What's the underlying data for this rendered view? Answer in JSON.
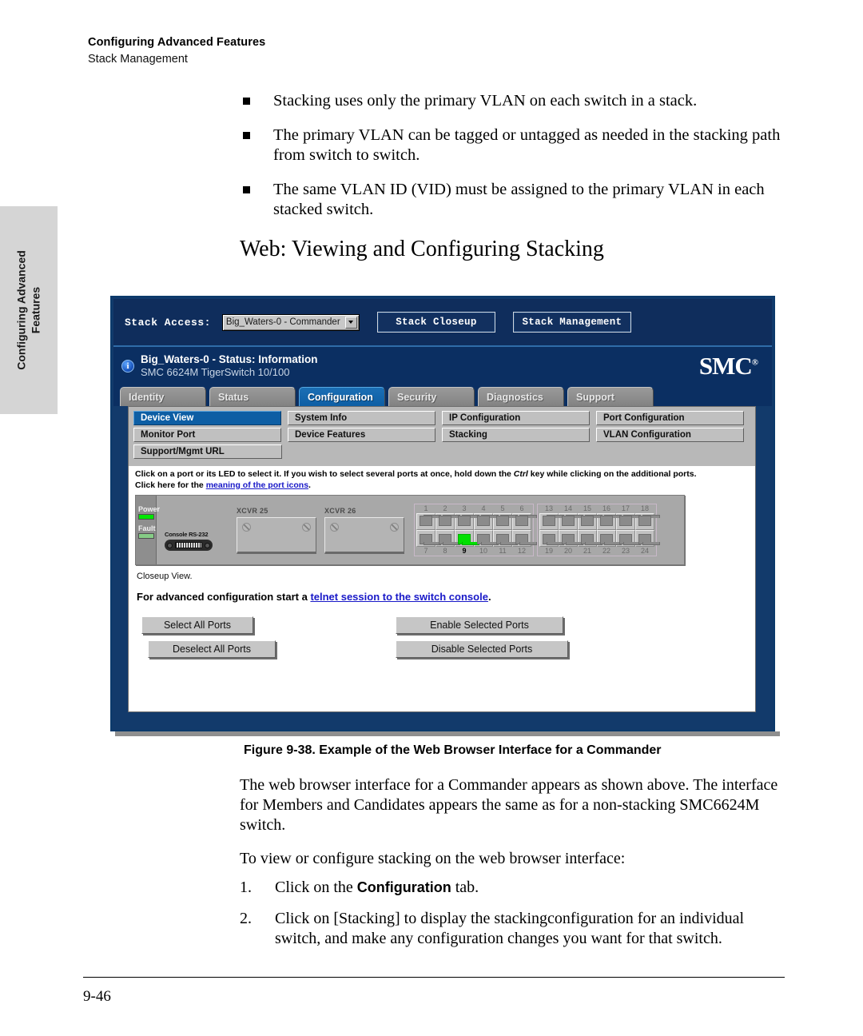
{
  "running_head": {
    "chapter": "Configuring Advanced Features",
    "section": "Stack Management"
  },
  "thumb_tab": {
    "line1": "Configuring Advanced",
    "line2": "Features"
  },
  "bullets": [
    "Stacking uses only the primary VLAN on each switch in a stack.",
    "The primary VLAN can be tagged or untagged as needed in the stacking path from switch to switch.",
    "The same VLAN ID (VID) must be assigned to the primary VLAN in each stacked switch."
  ],
  "heading": "Web: Viewing and Configuring Stacking",
  "screenshot": {
    "toolbar": {
      "stack_access_label": "Stack Access:",
      "stack_access_value": "Big_Waters-0 - Commander",
      "stack_closeup_button": "Stack Closeup",
      "stack_management_button": "Stack Management"
    },
    "status": {
      "title": "Big_Waters-0 - Status: Information",
      "subtitle": "SMC 6624M TigerSwitch 10/100",
      "logo": "SMC"
    },
    "tabs": [
      {
        "label": "Identity",
        "active": false
      },
      {
        "label": "Status",
        "active": false
      },
      {
        "label": "Configuration",
        "active": true
      },
      {
        "label": "Security",
        "active": false
      },
      {
        "label": "Diagnostics",
        "active": false
      },
      {
        "label": "Support",
        "active": false
      }
    ],
    "subtabs": [
      [
        "Device View",
        "System Info",
        "IP Configuration",
        "Port Configuration"
      ],
      [
        "Monitor Port",
        "Device Features",
        "Stacking",
        "VLAN Configuration"
      ],
      [
        "Support/Mgmt URL"
      ]
    ],
    "selected_subtab": "Device View",
    "instructions": {
      "line1_a": "Click on a port or its LED to select it. If you wish to select several ports at once, hold down the ",
      "line1_key": "Ctrl",
      "line1_b": " key while clicking on the additional ports.",
      "line2_a": "Click here for the ",
      "line2_link": "meaning of the port icons",
      "line2_b": "."
    },
    "device": {
      "leds": [
        {
          "label": "Power",
          "state": "on"
        },
        {
          "label": "Fault",
          "state": "dim"
        }
      ],
      "console_label": "Console RS-232",
      "xcvr": [
        "XCVR 25",
        "XCVR 26"
      ],
      "port_group_1": {
        "top_numbers": [
          "1",
          "2",
          "3",
          "4",
          "5",
          "6"
        ],
        "bottom_numbers": [
          "7",
          "8",
          "9",
          "10",
          "11",
          "12"
        ],
        "selected_port": "9"
      },
      "port_group_2": {
        "top_numbers": [
          "13",
          "14",
          "15",
          "16",
          "17",
          "18"
        ],
        "bottom_numbers": [
          "19",
          "20",
          "21",
          "22",
          "23",
          "24"
        ],
        "selected_port": ""
      },
      "closeup_label": "Closeup View."
    },
    "advanced": {
      "prefix": "For advanced configuration start a ",
      "link": "telnet session to the switch console",
      "suffix": "."
    },
    "buttons": {
      "select_all": "Select All Ports",
      "deselect_all": "Deselect All Ports",
      "enable_selected": "Enable Selected Ports",
      "disable_selected": "Disable Selected Ports"
    },
    "colors": {
      "chrome_blue": "#0f2d5c",
      "active_tab_blue": "#0d5ea4",
      "led_green": "#00e800",
      "link_blue": "#1818c8"
    }
  },
  "figure_caption": "Figure 9-38.  Example of the Web Browser Interface for a Commander",
  "after_figure_paragraph": "The web browser interface for a Commander appears as shown above. The interface for Members and Candidates appears the same as for a non-stacking SMC6624M switch.",
  "lead_in": "To view or configure stacking on the web browser interface:",
  "steps": [
    {
      "number": "1.",
      "pre": "Click on the ",
      "bold": "Configuration",
      "post": " tab."
    },
    {
      "number": "2.",
      "pre": "Click on [Stacking] to display the stackingconfiguration for an individual switch, and make any configuration changes you want for that switch.",
      "bold": "",
      "post": ""
    }
  ],
  "page_number": "9-46"
}
